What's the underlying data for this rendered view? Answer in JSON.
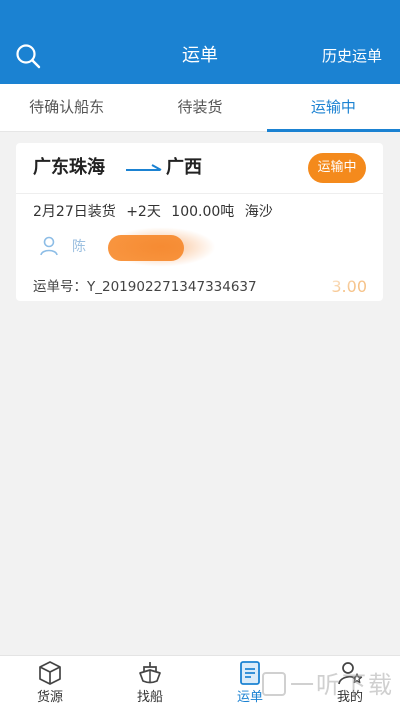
{
  "header": {
    "title": "运单",
    "history_label": "历史运单",
    "search_icon": "search-icon",
    "background": "#1b82d2"
  },
  "tabs": [
    {
      "label": "待确认船东",
      "active": false
    },
    {
      "label": "待装货",
      "active": false
    },
    {
      "label": "运输中",
      "active": true
    }
  ],
  "order": {
    "from": "广东珠海",
    "to": "广西",
    "status": "运输中",
    "load_date": "2月27日装货",
    "days": "+2天",
    "weight": "100.00吨",
    "cargo": "海沙",
    "driver_name": "陈",
    "order_no": "运单号：Y_201902271347334637",
    "price": "3.00",
    "status_color": "#f48a1c"
  },
  "bottom_nav": [
    {
      "label": "货源",
      "icon": "box-icon",
      "active": false
    },
    {
      "label": "找船",
      "icon": "ship-icon",
      "active": false
    },
    {
      "label": "运单",
      "icon": "document-icon",
      "active": true
    },
    {
      "label": "我的",
      "icon": "user-star-icon",
      "active": false
    }
  ],
  "watermark": "一听下载"
}
